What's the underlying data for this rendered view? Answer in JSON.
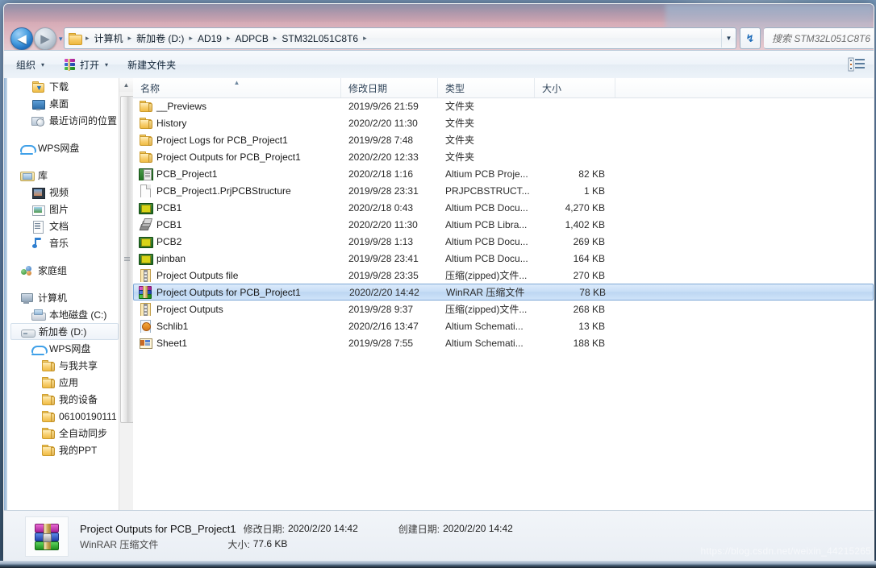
{
  "window": {
    "address": {
      "crumbs": [
        "计算机",
        "新加卷 (D:)",
        "AD19",
        "ADPCB",
        "STM32L051C8T6"
      ],
      "separator": "▸",
      "folder_icon": "folder-icon",
      "dropdown_icon": "chevron-down-icon"
    },
    "back_button": {
      "icon": "back-arrow-icon",
      "glyph": "◀"
    },
    "forward_button": {
      "icon": "forward-arrow-icon",
      "glyph": "▶"
    },
    "history_dropdown": {
      "icon": "chevron-down-icon",
      "glyph": "▾"
    },
    "refresh_button": {
      "icon": "refresh-icon",
      "glyph": "↯"
    },
    "search": {
      "placeholder": "搜索 STM32L051C8T6",
      "value": ""
    }
  },
  "toolbar": {
    "organize_label": "组织",
    "organize_caret": "▾",
    "open_label": "打开",
    "open_caret": "▾",
    "new_folder_label": "新建文件夹",
    "view_icon": "view-mode-icon"
  },
  "sidebar": {
    "items": [
      {
        "label": "下载",
        "icon": "downloads-folder-icon",
        "level": 2,
        "gap_before": false,
        "selected": false
      },
      {
        "label": "桌面",
        "icon": "desktop-icon",
        "level": 2,
        "gap_before": false,
        "selected": false
      },
      {
        "label": "最近访问的位置",
        "icon": "recent-places-icon",
        "level": 2,
        "gap_before": false,
        "selected": false
      },
      {
        "label": "WPS网盘",
        "icon": "cloud-icon",
        "level": 1,
        "gap_before": true,
        "selected": false
      },
      {
        "label": "库",
        "icon": "library-icon",
        "level": 1,
        "gap_before": true,
        "selected": false
      },
      {
        "label": "视频",
        "icon": "video-icon",
        "level": 2,
        "gap_before": false,
        "selected": false
      },
      {
        "label": "图片",
        "icon": "picture-icon",
        "level": 2,
        "gap_before": false,
        "selected": false
      },
      {
        "label": "文档",
        "icon": "document-icon",
        "level": 2,
        "gap_before": false,
        "selected": false
      },
      {
        "label": "音乐",
        "icon": "music-icon",
        "level": 2,
        "gap_before": false,
        "selected": false
      },
      {
        "label": "家庭组",
        "icon": "homegroup-icon",
        "level": 1,
        "gap_before": true,
        "selected": false
      },
      {
        "label": "计算机",
        "icon": "computer-icon",
        "level": 1,
        "gap_before": true,
        "selected": false
      },
      {
        "label": "本地磁盘 (C:)",
        "icon": "harddisk-icon",
        "level": 2,
        "gap_before": false,
        "selected": false
      },
      {
        "label": "新加卷 (D:)",
        "icon": "drive-icon",
        "level": 2,
        "gap_before": false,
        "selected": true
      },
      {
        "label": "WPS网盘",
        "icon": "cloud-icon",
        "level": 2,
        "gap_before": false,
        "selected": false
      },
      {
        "label": "与我共享",
        "icon": "folder-icon",
        "level": 3,
        "gap_before": false,
        "selected": false
      },
      {
        "label": "应用",
        "icon": "folder-icon",
        "level": 3,
        "gap_before": false,
        "selected": false
      },
      {
        "label": "我的设备",
        "icon": "folder-icon",
        "level": 3,
        "gap_before": false,
        "selected": false
      },
      {
        "label": "06100190111",
        "icon": "folder-icon",
        "level": 3,
        "gap_before": false,
        "selected": false
      },
      {
        "label": "全自动同步",
        "icon": "folder-icon",
        "level": 3,
        "gap_before": false,
        "selected": false
      },
      {
        "label": "我的PPT",
        "icon": "folder-icon",
        "level": 3,
        "gap_before": false,
        "selected": false
      }
    ],
    "scrollbar": {
      "up_arrow": "▲",
      "down_arrow": "▼",
      "grip_icon": "scrollbar-grip-icon"
    }
  },
  "filepane": {
    "columns": [
      {
        "key": "name",
        "label": "名称",
        "sorted": true,
        "sort_caret": "▲"
      },
      {
        "key": "date",
        "label": "修改日期",
        "sorted": false,
        "sort_caret": ""
      },
      {
        "key": "type",
        "label": "类型",
        "sorted": false,
        "sort_caret": ""
      },
      {
        "key": "size",
        "label": "大小",
        "sorted": false,
        "sort_caret": ""
      }
    ],
    "rows": [
      {
        "name": "__Previews",
        "date": "2019/9/26 21:59",
        "type": "文件夹",
        "size": "",
        "icon": "folder-icon",
        "selected": false
      },
      {
        "name": "History",
        "date": "2020/2/20 11:30",
        "type": "文件夹",
        "size": "",
        "icon": "folder-icon",
        "selected": false
      },
      {
        "name": "Project Logs for PCB_Project1",
        "date": "2019/9/28 7:48",
        "type": "文件夹",
        "size": "",
        "icon": "folder-icon",
        "selected": false
      },
      {
        "name": "Project Outputs for PCB_Project1",
        "date": "2020/2/20 12:33",
        "type": "文件夹",
        "size": "",
        "icon": "folder-icon",
        "selected": false
      },
      {
        "name": "PCB_Project1",
        "date": "2020/2/18 1:16",
        "type": "Altium PCB Proje...",
        "size": "82 KB",
        "icon": "altium-pcb-project-icon",
        "selected": false
      },
      {
        "name": "PCB_Project1.PrjPCBStructure",
        "date": "2019/9/28 23:31",
        "type": "PRJPCBSTRUCT...",
        "size": "1 KB",
        "icon": "generic-file-icon",
        "selected": false
      },
      {
        "name": "PCB1",
        "date": "2020/2/18 0:43",
        "type": "Altium PCB Docu...",
        "size": "4,270 KB",
        "icon": "altium-pcb-document-icon",
        "selected": false
      },
      {
        "name": "PCB1",
        "date": "2020/2/20 11:30",
        "type": "Altium PCB Libra...",
        "size": "1,402 KB",
        "icon": "altium-pcb-library-icon",
        "selected": false
      },
      {
        "name": "PCB2",
        "date": "2019/9/28 1:13",
        "type": "Altium PCB Docu...",
        "size": "269 KB",
        "icon": "altium-pcb-document-icon",
        "selected": false
      },
      {
        "name": "pinban",
        "date": "2019/9/28 23:41",
        "type": "Altium PCB Docu...",
        "size": "164 KB",
        "icon": "altium-pcb-document-icon",
        "selected": false
      },
      {
        "name": "Project Outputs file",
        "date": "2019/9/28 23:35",
        "type": "压缩(zipped)文件...",
        "size": "270 KB",
        "icon": "zip-file-icon",
        "selected": false
      },
      {
        "name": "Project Outputs for PCB_Project1",
        "date": "2020/2/20 14:42",
        "type": "WinRAR 压缩文件",
        "size": "78 KB",
        "icon": "winrar-archive-icon",
        "selected": true
      },
      {
        "name": "Project Outputs",
        "date": "2019/9/28 9:37",
        "type": "压缩(zipped)文件...",
        "size": "268 KB",
        "icon": "zip-file-icon",
        "selected": false
      },
      {
        "name": "Schlib1",
        "date": "2020/2/16 13:47",
        "type": "Altium Schemati...",
        "size": "13 KB",
        "icon": "altium-schematic-library-icon",
        "selected": false
      },
      {
        "name": "Sheet1",
        "date": "2019/9/28 7:55",
        "type": "Altium Schemati...",
        "size": "188 KB",
        "icon": "altium-schematic-icon",
        "selected": false
      }
    ]
  },
  "details_pane": {
    "icon": "winrar-archive-icon",
    "file_name": "Project Outputs for PCB_Project1",
    "file_type": "WinRAR 压缩文件",
    "modified_key": "修改日期:",
    "modified_value": "2020/2/20 14:42",
    "created_key": "创建日期:",
    "created_value": "2020/2/20 14:42",
    "size_key": "大小:",
    "size_value": "77.6 KB"
  },
  "watermark": {
    "text": "https://blog.csdn.net/weixin_44215265"
  },
  "colors": {
    "selection_blue": "#c6ddf6",
    "selection_border": "#7ea8d6",
    "title_pink": "#d5a5b1",
    "toolbar_bg": "#eef3f9"
  }
}
